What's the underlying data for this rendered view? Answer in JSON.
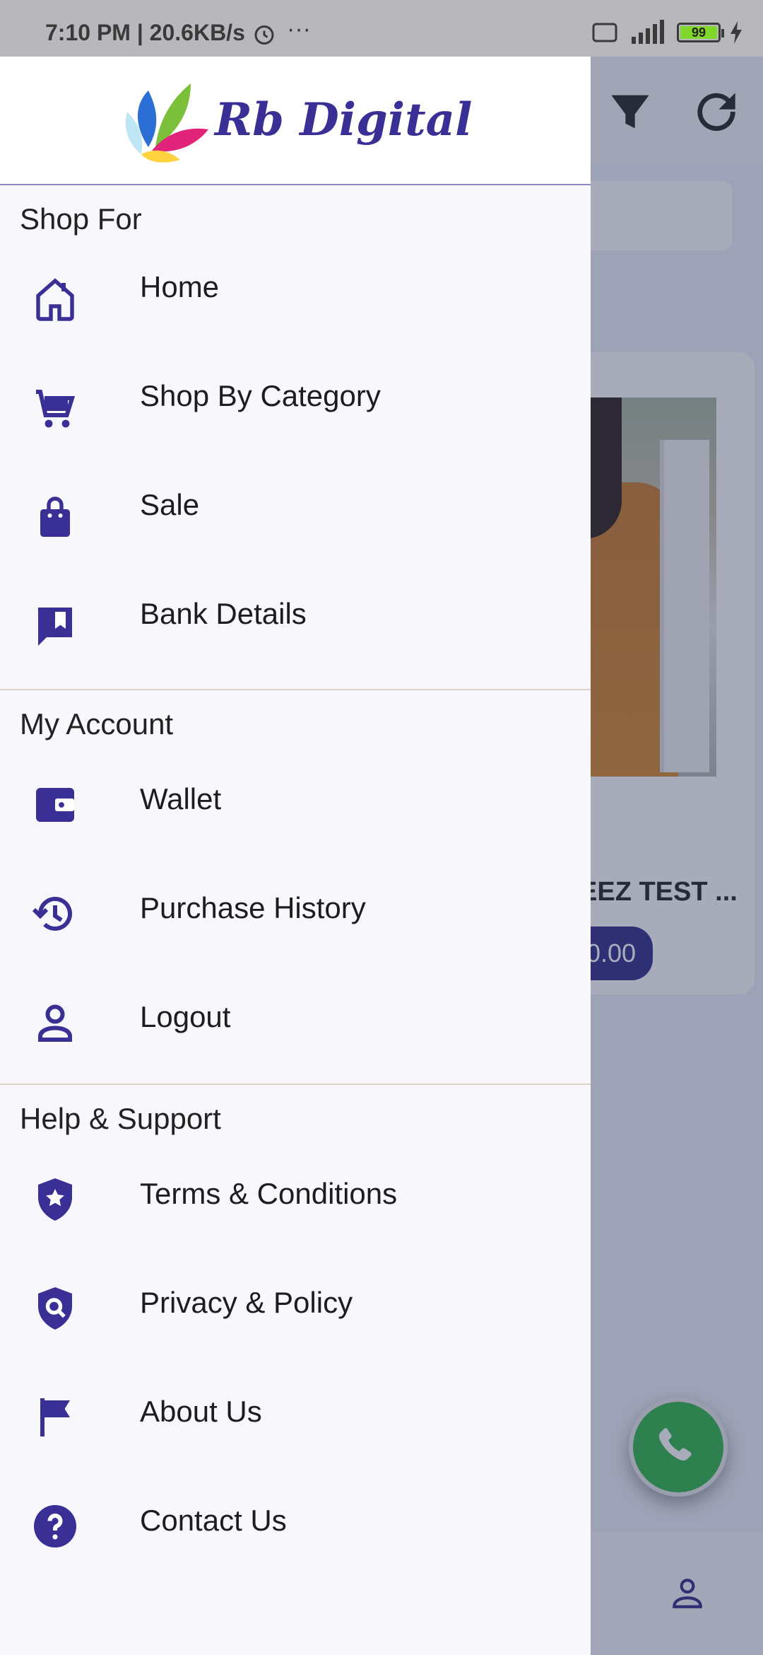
{
  "status_bar": {
    "time": "7:10 PM | 20.6KB/s",
    "battery": "99"
  },
  "drawer": {
    "logo_text": "Rb Digital",
    "sections": [
      {
        "title": "Shop For",
        "items": [
          {
            "label": "Home",
            "icon": "home-icon"
          },
          {
            "label": "Shop By Category",
            "icon": "cart-icon"
          },
          {
            "label": "Sale",
            "icon": "shopping-bag-icon"
          },
          {
            "label": "Bank Details",
            "icon": "bookmark-chat-icon"
          }
        ]
      },
      {
        "title": "My Account",
        "items": [
          {
            "label": "Wallet",
            "icon": "wallet-icon"
          },
          {
            "label": "Purchase History",
            "icon": "history-icon"
          },
          {
            "label": "Logout",
            "icon": "person-icon"
          }
        ]
      },
      {
        "title": "Help & Support",
        "items": [
          {
            "label": "Terms & Conditions",
            "icon": "shield-star-icon"
          },
          {
            "label": "Privacy & Policy",
            "icon": "shield-search-icon"
          },
          {
            "label": "About Us",
            "icon": "flag-icon"
          },
          {
            "label": "Contact Us",
            "icon": "help-icon"
          }
        ]
      }
    ]
  },
  "background_app": {
    "product_title": "EEZ TEST ...",
    "price": "0.00"
  },
  "colors": {
    "accent": "#3a2f95",
    "drawer_bg": "#f7f7fc",
    "whatsapp": "#2fb548"
  }
}
